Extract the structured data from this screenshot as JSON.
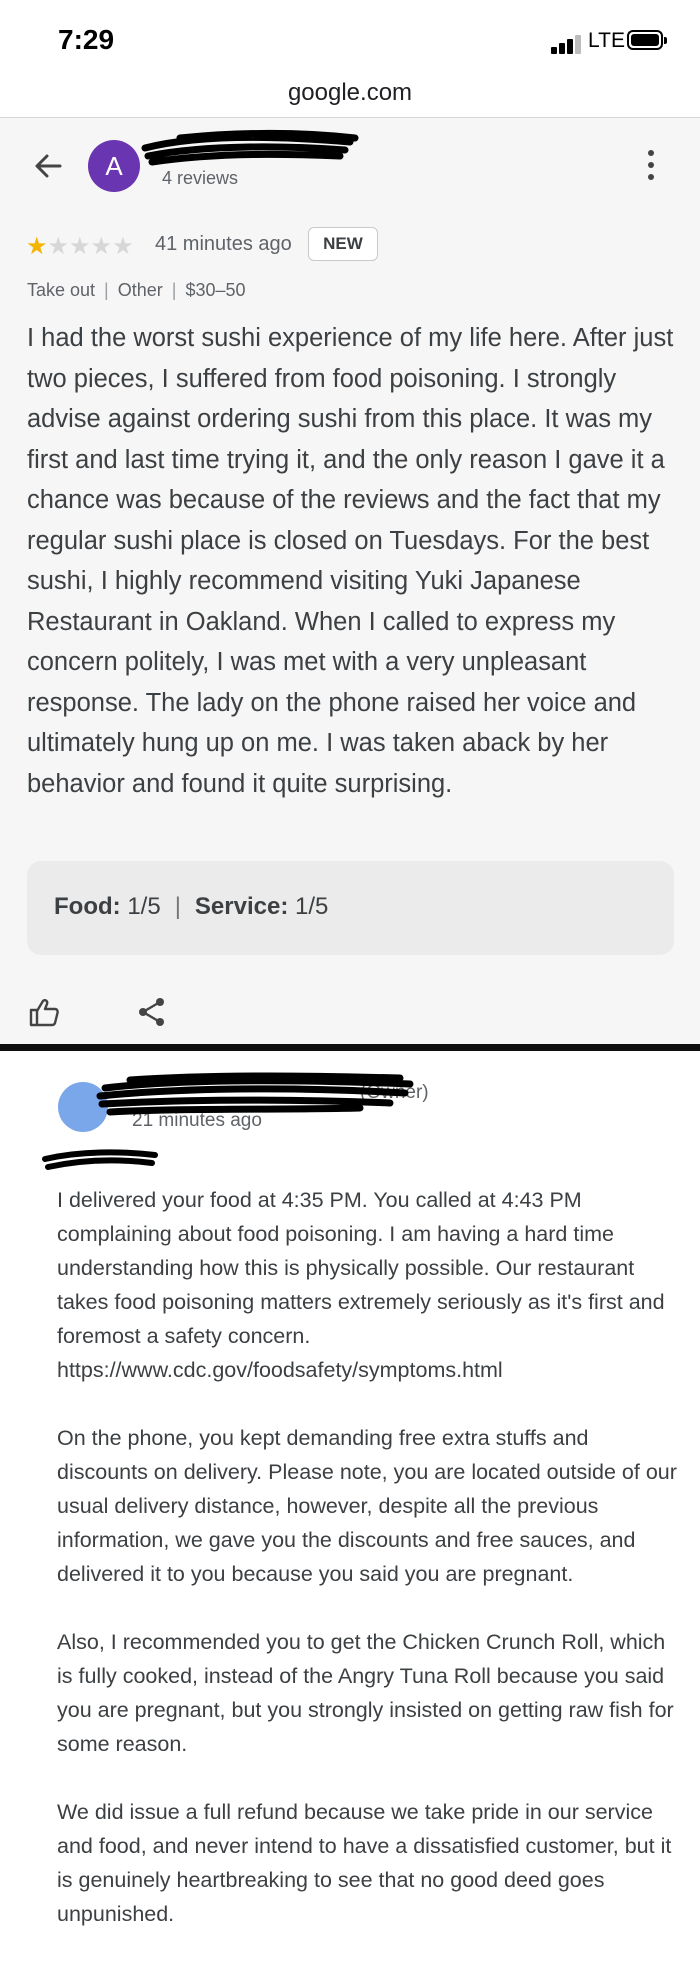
{
  "status_bar": {
    "time": "7:29",
    "network": "LTE"
  },
  "browser": {
    "url": "google.com"
  },
  "review": {
    "avatar_letter": "A",
    "reviewer_count": "4 reviews",
    "rating": 1,
    "rating_max": 5,
    "time_ago": "41 minutes ago",
    "badge": "NEW",
    "meta": [
      "Take out",
      "Other",
      "$30–50"
    ],
    "text": "I had the worst sushi experience of my life here. After just two pieces, I suffered from food poisoning. I strongly advise against ordering sushi from this place. It was my first and last time trying it, and the only reason I gave it a chance was because of the reviews and the fact that my regular sushi place is closed on Tuesdays. For the best sushi, I highly recommend visiting Yuki Japanese Restaurant in Oakland. When I called to express my concern politely, I was met with a very unpleasant response. The lady on the phone raised her voice and ultimately hung up on me. I was taken aback by her behavior and found it quite surprising.",
    "food_label": "Food:",
    "food_value": "1/5",
    "service_label": "Service:",
    "service_value": "1/5"
  },
  "owner_response": {
    "name_suffix": "(Owner)",
    "time_ago": "21 minutes ago",
    "paragraphs": [
      "I delivered your food at 4:35 PM. You called at 4:43 PM complaining about food poisoning. I am having a hard time understanding how this is physically possible. Our restaurant takes food poisoning matters extremely seriously as it's first and foremost a safety concern. https://www.cdc.gov/foodsafety/symptoms.html",
      "On the phone, you kept demanding free extra stuffs and discounts on delivery. Please note, you are located outside of our usual delivery distance, however, despite all the previous information, we gave you the discounts and free sauces, and delivered it to you because you said you are pregnant.",
      "Also, I recommended you to get the Chicken Crunch Roll, which is fully cooked, instead of the Angry Tuna Roll because you said you are pregnant, but you strongly insisted on getting raw fish for some reason.",
      "We did issue a full refund because we take pride in our service and food, and never intend to have a dissatisfied customer, but it is genuinely heartbreaking to see that no good deed goes unpunished."
    ]
  },
  "colors": {
    "avatar": "#6a35b0",
    "star": "#f4b400",
    "owner_avatar": "#7aa7ea"
  },
  "icons": [
    "back-arrow-icon",
    "more-vert-icon",
    "star-icon",
    "thumbs-up-icon",
    "share-icon",
    "signal-icon",
    "battery-icon"
  ]
}
